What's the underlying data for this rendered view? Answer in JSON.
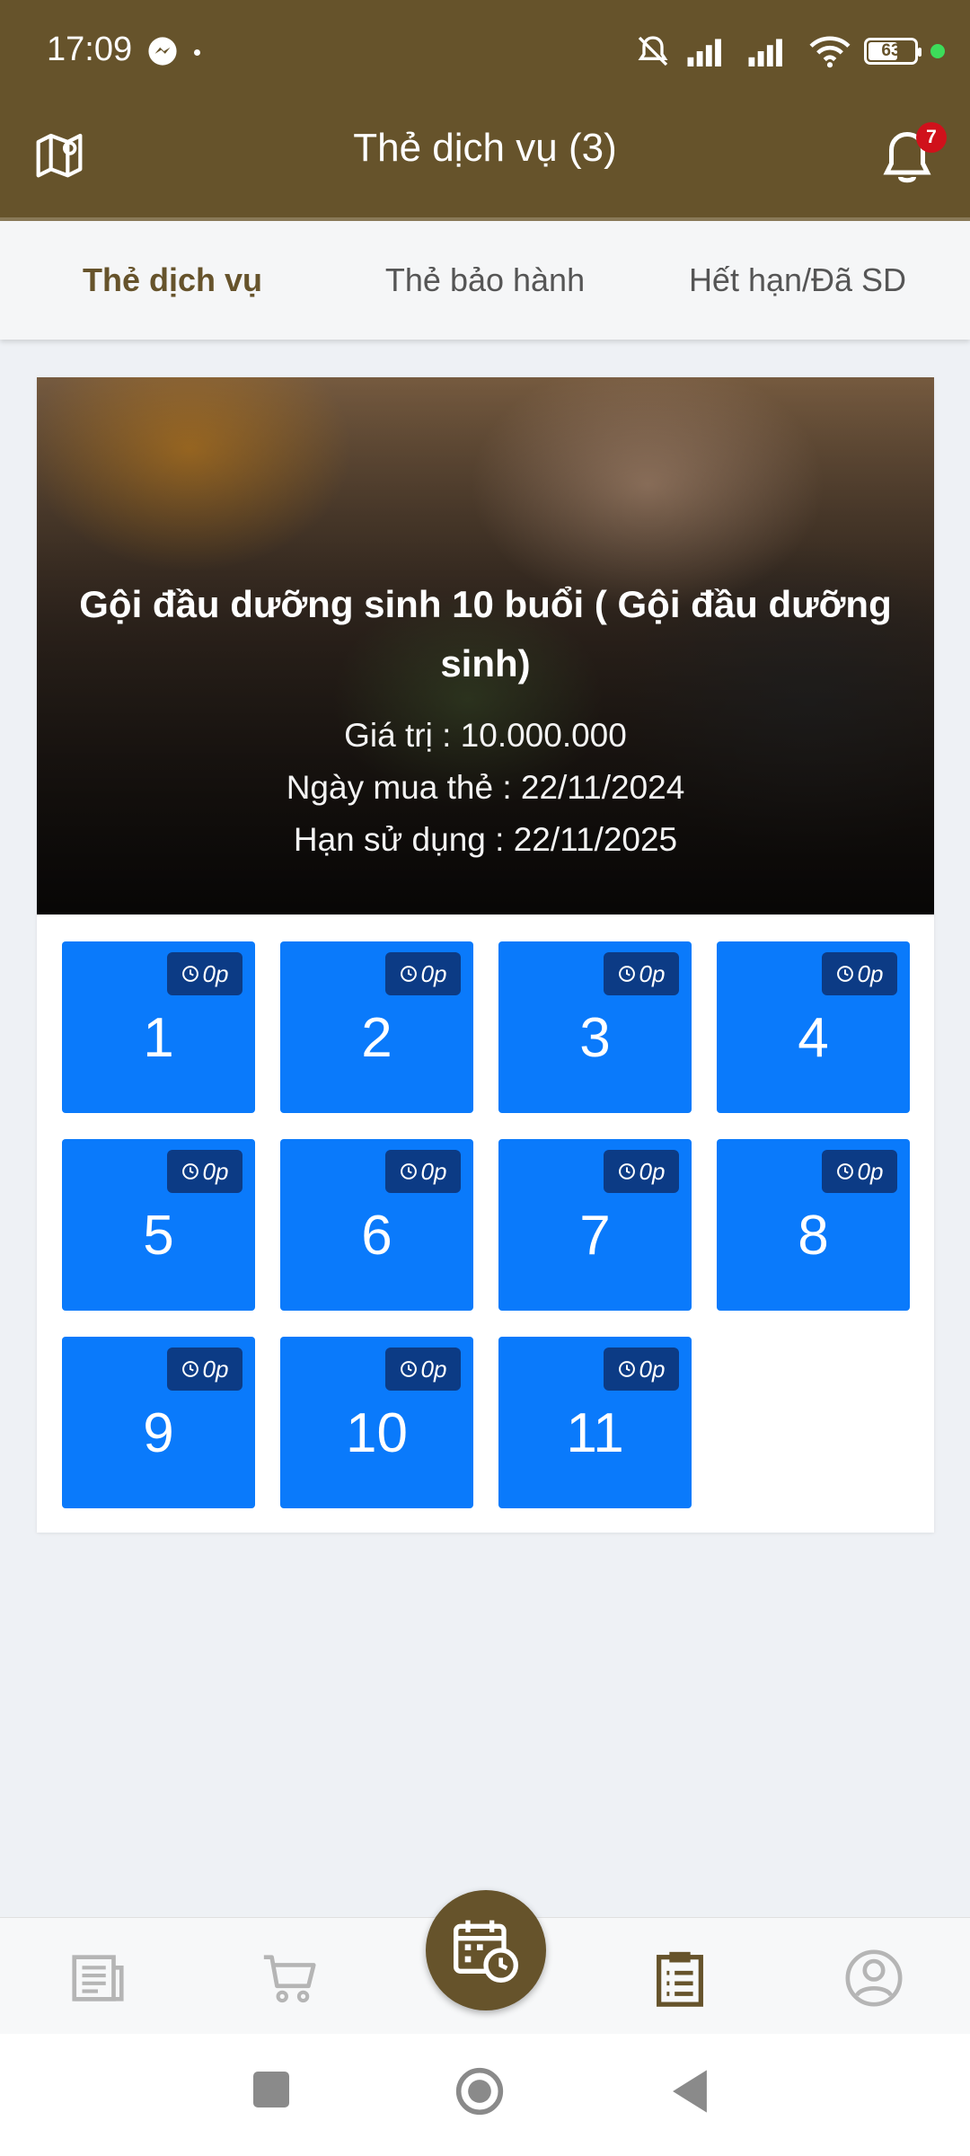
{
  "status_bar": {
    "time": "17:09",
    "battery": "63"
  },
  "header": {
    "title": "Thẻ dịch vụ (3)",
    "notification_count": "7"
  },
  "tabs": [
    {
      "label": "Thẻ dịch vụ",
      "active": true
    },
    {
      "label": "Thẻ bảo hành",
      "active": false
    },
    {
      "label": "Hết hạn/Đã SD",
      "active": false
    }
  ],
  "card": {
    "title": "Gội đầu dưỡng sinh 10 buổi ( Gội đầu dưỡng sinh)",
    "value_line": "Giá trị : 10.000.000",
    "purchase_line": "Ngày mua thẻ : 22/11/2024",
    "expiry_line": "Hạn sử dụng : 22/11/2025",
    "sessions": [
      {
        "number": "1",
        "time": "0p"
      },
      {
        "number": "2",
        "time": "0p"
      },
      {
        "number": "3",
        "time": "0p"
      },
      {
        "number": "4",
        "time": "0p"
      },
      {
        "number": "5",
        "time": "0p"
      },
      {
        "number": "6",
        "time": "0p"
      },
      {
        "number": "7",
        "time": "0p"
      },
      {
        "number": "8",
        "time": "0p"
      },
      {
        "number": "9",
        "time": "0p"
      },
      {
        "number": "10",
        "time": "0p"
      },
      {
        "number": "11",
        "time": "0p"
      }
    ]
  },
  "bottom_nav": {
    "items": [
      "news-icon",
      "cart-icon",
      "calendar-clock-icon",
      "clipboard-icon",
      "user-icon"
    ],
    "active": "clipboard-icon"
  },
  "colors": {
    "brand": "#66532b",
    "tile": "#0a7afb",
    "badge": "#d0111b"
  }
}
